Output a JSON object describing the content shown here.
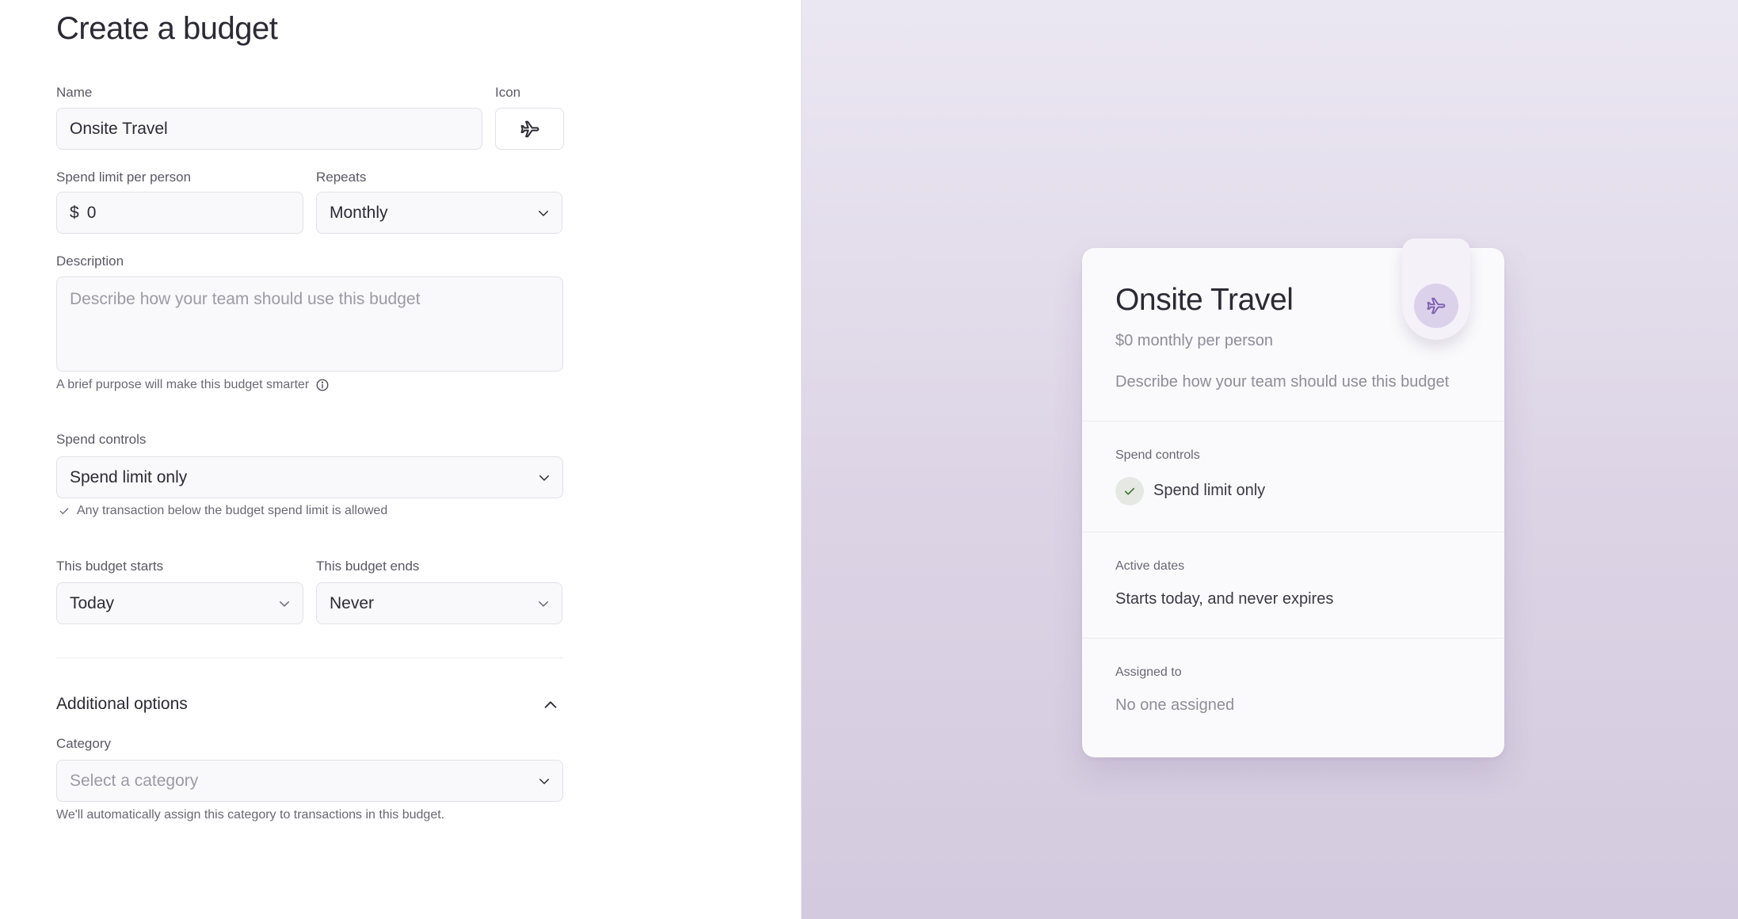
{
  "page": {
    "title": "Create a budget"
  },
  "form": {
    "name": {
      "label": "Name",
      "value": "Onsite Travel"
    },
    "icon": {
      "label": "Icon",
      "icon": "airplane-icon"
    },
    "spend_limit": {
      "label": "Spend limit per person",
      "currency": "$",
      "value": "0"
    },
    "repeats": {
      "label": "Repeats",
      "value": "Monthly"
    },
    "description": {
      "label": "Description",
      "placeholder": "Describe how your team should use this budget",
      "hint": "A brief purpose will make this budget smarter"
    },
    "spend_controls": {
      "label": "Spend controls",
      "value": "Spend limit only",
      "hint": "Any transaction below the budget spend limit is allowed"
    },
    "starts": {
      "label": "This budget starts",
      "value": "Today"
    },
    "ends": {
      "label": "This budget ends",
      "value": "Never"
    },
    "additional_options": {
      "heading": "Additional options",
      "category": {
        "label": "Category",
        "placeholder": "Select a category",
        "hint": "We'll automatically assign this category to transactions in this budget."
      }
    }
  },
  "preview": {
    "title": "Onsite Travel",
    "subtitle": "$0 monthly per person",
    "description": "Describe how your team should use this budget",
    "spend_controls": {
      "label": "Spend controls",
      "value": "Spend limit only"
    },
    "active_dates": {
      "label": "Active dates",
      "value": "Starts today, and never expires"
    },
    "assigned_to": {
      "label": "Assigned to",
      "value": "No one assigned"
    }
  },
  "colors": {
    "text": "#2b2a35",
    "muted": "#8f8d99",
    "field_bg": "#f9f9fb",
    "field_border": "#e1e0e8",
    "preview_bg": "#dcd4e5",
    "accent_purple": "#7c5fb0"
  }
}
